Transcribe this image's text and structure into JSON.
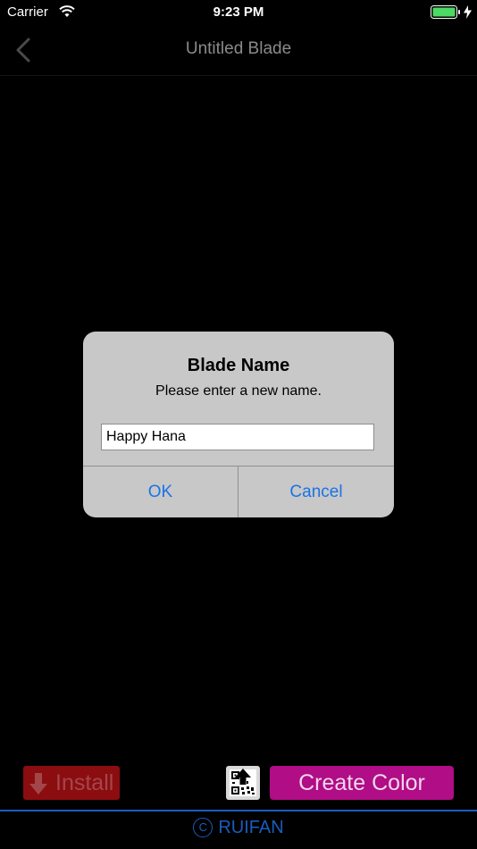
{
  "status_bar": {
    "carrier": "Carrier",
    "time": "9:23 PM"
  },
  "nav": {
    "title": "Untitled Blade",
    "back_icon": "chevron-left-icon"
  },
  "dialog": {
    "title": "Blade Name",
    "message": "Please enter a new name.",
    "input_value": "Happy Hana",
    "ok_label": "OK",
    "cancel_label": "Cancel"
  },
  "toolbar": {
    "install_label": "Install",
    "qr_icon": "qr-upload-icon",
    "create_label": "Create Color"
  },
  "footer": {
    "copyright_symbol": "C",
    "brand": "RUIFAN"
  },
  "colors": {
    "accent_blue": "#1a73e8",
    "install_red": "#8b0d10",
    "create_magenta": "#b00d86",
    "footer_blue": "#1a5cbd"
  }
}
